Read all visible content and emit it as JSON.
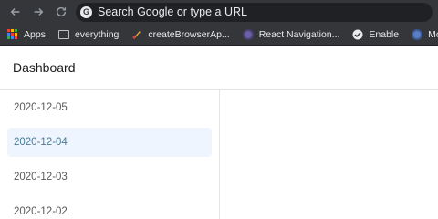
{
  "browser": {
    "omnibox_placeholder": "Search Google or type a URL",
    "bookmarks": [
      {
        "label": "Apps",
        "icon": "apps-grid-icon"
      },
      {
        "label": "everything",
        "icon": "folder-icon"
      },
      {
        "label": "createBrowserAp...",
        "icon": "bookmark-favicon"
      },
      {
        "label": "React Navigation...",
        "icon": "react-navigation-favicon"
      },
      {
        "label": "Enable",
        "icon": "enable-favicon"
      },
      {
        "label": "Moment",
        "icon": "moment-favicon"
      }
    ]
  },
  "header": {
    "title": "Dashboard"
  },
  "sidebar": {
    "items": [
      {
        "label": "2020-12-05",
        "active": false
      },
      {
        "label": "2020-12-04",
        "active": true
      },
      {
        "label": "2020-12-03",
        "active": false
      },
      {
        "label": "2020-12-02",
        "active": false
      }
    ]
  },
  "colors": {
    "chrome_bg": "#35363a",
    "omnibox_bg": "#202124",
    "active_item_bg": "#eef5ff",
    "active_item_text": "#4a7a96"
  }
}
